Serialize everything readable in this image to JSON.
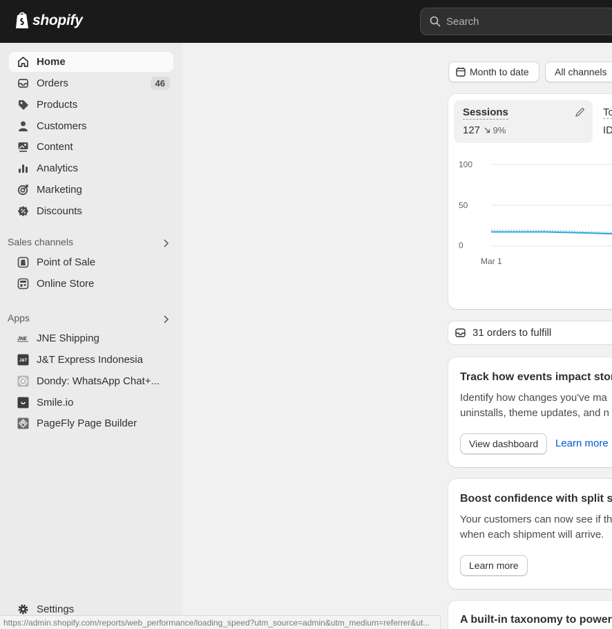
{
  "brand": {
    "name": "shopify"
  },
  "search": {
    "placeholder": "Search"
  },
  "sidebar": {
    "items": [
      {
        "label": "Home",
        "icon": "home-icon"
      },
      {
        "label": "Orders",
        "icon": "inbox-icon",
        "badge": "46"
      },
      {
        "label": "Products",
        "icon": "tag-icon"
      },
      {
        "label": "Customers",
        "icon": "person-icon"
      },
      {
        "label": "Content",
        "icon": "image-icon"
      },
      {
        "label": "Analytics",
        "icon": "bar-chart-icon"
      },
      {
        "label": "Marketing",
        "icon": "target-icon"
      },
      {
        "label": "Discounts",
        "icon": "discount-icon"
      }
    ],
    "sales_channels_title": "Sales channels",
    "sales_channels": [
      {
        "label": "Point of Sale",
        "icon": "pos-icon"
      },
      {
        "label": "Online Store",
        "icon": "store-icon"
      }
    ],
    "apps_title": "Apps",
    "apps": [
      {
        "label": "JNE Shipping",
        "icon": "jne-icon"
      },
      {
        "label": "J&T Express Indonesia",
        "icon": "jt-icon"
      },
      {
        "label": "Dondy: WhatsApp Chat+...",
        "icon": "whatsapp-icon"
      },
      {
        "label": "Smile.io",
        "icon": "smile-icon"
      },
      {
        "label": "PageFly Page Builder",
        "icon": "pagefly-icon"
      }
    ],
    "settings_label": "Settings"
  },
  "filters": {
    "date_label": "Month to date",
    "channels_label": "All channels"
  },
  "sessions_card": {
    "metric_title": "Sessions",
    "metric_value": "127",
    "metric_delta": "9%",
    "second_metric_partial": "To",
    "second_metric_value_partial": "ID",
    "y_ticks": [
      "100",
      "50",
      "0"
    ],
    "x_ticks": [
      "Mar 1"
    ]
  },
  "orders_to_fulfill": "31 orders to fulfill",
  "events_card": {
    "title": "Track how events impact store",
    "body_line1": "Identify how changes you've ma",
    "body_line2": "uninstalls, theme updates, and n",
    "button": "View dashboard",
    "link": "Learn more"
  },
  "split_card": {
    "title": "Boost confidence with split sh",
    "body_line1": "Your customers can now see if th",
    "body_line2": "when each shipment will arrive.",
    "button": "Learn more"
  },
  "taxonomy_card": {
    "title": "A built-in taxonomy to power p"
  },
  "status_url": "https://admin.shopify.com/reports/web_performance/loading_speed?utm_source=admin&utm_medium=referrer&ut..."
}
